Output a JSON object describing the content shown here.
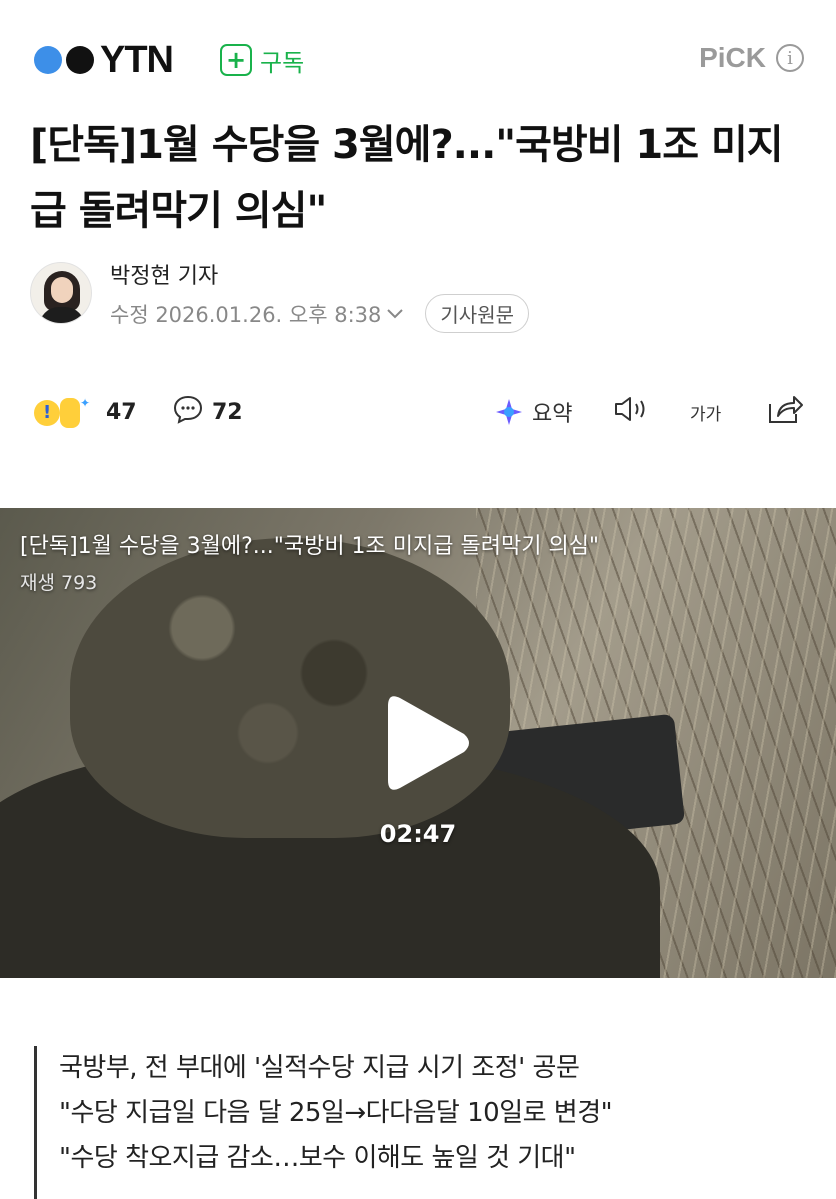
{
  "header": {
    "logo_text": "YTN",
    "subscribe_label": "구독",
    "pick_label": "PiCK",
    "info_symbol": "i"
  },
  "article": {
    "title": "[단독]1월 수당을 3월에?...\"국방비 1조 미지급 돌려막기 의심\"",
    "reporter": "박정현 기자",
    "modified": "수정 2026.01.26. 오후 8:38",
    "original_button": "기사원문"
  },
  "actions": {
    "reaction_count": "47",
    "comment_count": "72",
    "summary_label": "요약",
    "font_size_label": "가가"
  },
  "video": {
    "title": "[단독]1월 수당을 3월에?...\"국방비 1조 미지급 돌려막기 의심\"",
    "views": "재생 793",
    "duration": "02:47"
  },
  "summary_lines": [
    "국방부, 전 부대에 '실적수당 지급 시기 조정' 공문",
    "\"수당 지급일 다음 달 25일→다다음달 10일로 변경\"",
    "\"수당 착오지급 감소…보수 이해도 높일 것 기대\""
  ],
  "colors": {
    "brand_green": "#19b24b",
    "logo_blue": "#3d8fe8",
    "muted_gray": "#888888"
  }
}
